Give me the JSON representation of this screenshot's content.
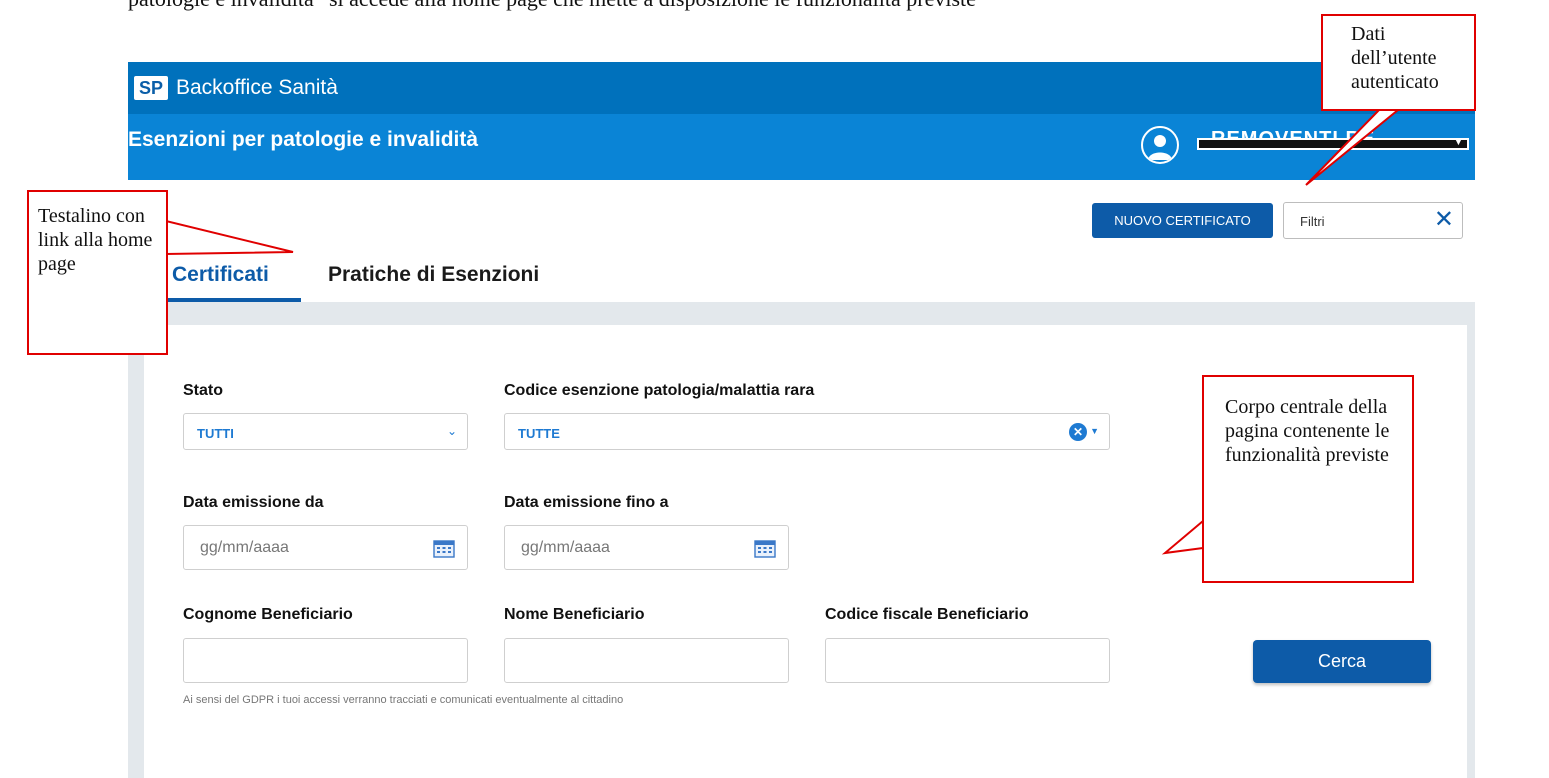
{
  "document": {
    "intro_text": "patologie e invalidità” si accede alla home page che mette a disposizione le funzionalità previste"
  },
  "app": {
    "logo": "SP",
    "title": "Backoffice Sanità",
    "module_title": "Esenzioni per patologie e invalidità",
    "user_name": "REMOVENTI RE..."
  },
  "toolbar": {
    "new_certificate_label": "NUOVO CERTIFICATO",
    "filter_label": "Filtri"
  },
  "tabs": [
    {
      "label": "Certificati",
      "active": true
    },
    {
      "label": "Pratiche di Esenzioni",
      "active": false
    }
  ],
  "form": {
    "stato": {
      "label": "Stato",
      "value": "TUTTI"
    },
    "codice": {
      "label": "Codice esenzione patologia/malattia rara",
      "value": "TUTTE"
    },
    "data_da": {
      "label": "Data emissione da",
      "placeholder": "gg/mm/aaaa"
    },
    "data_a": {
      "label": "Data emissione fino a",
      "placeholder": "gg/mm/aaaa"
    },
    "cognome": {
      "label": "Cognome Beneficiario"
    },
    "nome": {
      "label": "Nome Beneficiario"
    },
    "cf": {
      "label": "Codice fiscale Beneficiario"
    },
    "search_label": "Cerca",
    "gdpr_note": "Ai sensi del GDPR i tuoi accessi verranno tracciati e comunicati eventualmente al cittadino"
  },
  "callouts": {
    "user": "Dati dell’utente autenticato",
    "header": "Testalino con link alla home page",
    "body": "Corpo centrale della pagina contenente le funzionalità previste"
  },
  "colors": {
    "topbar": "#0071bc",
    "subbar": "#0a84d6",
    "primary": "#0d5ba8",
    "callout_border": "#e00000"
  }
}
